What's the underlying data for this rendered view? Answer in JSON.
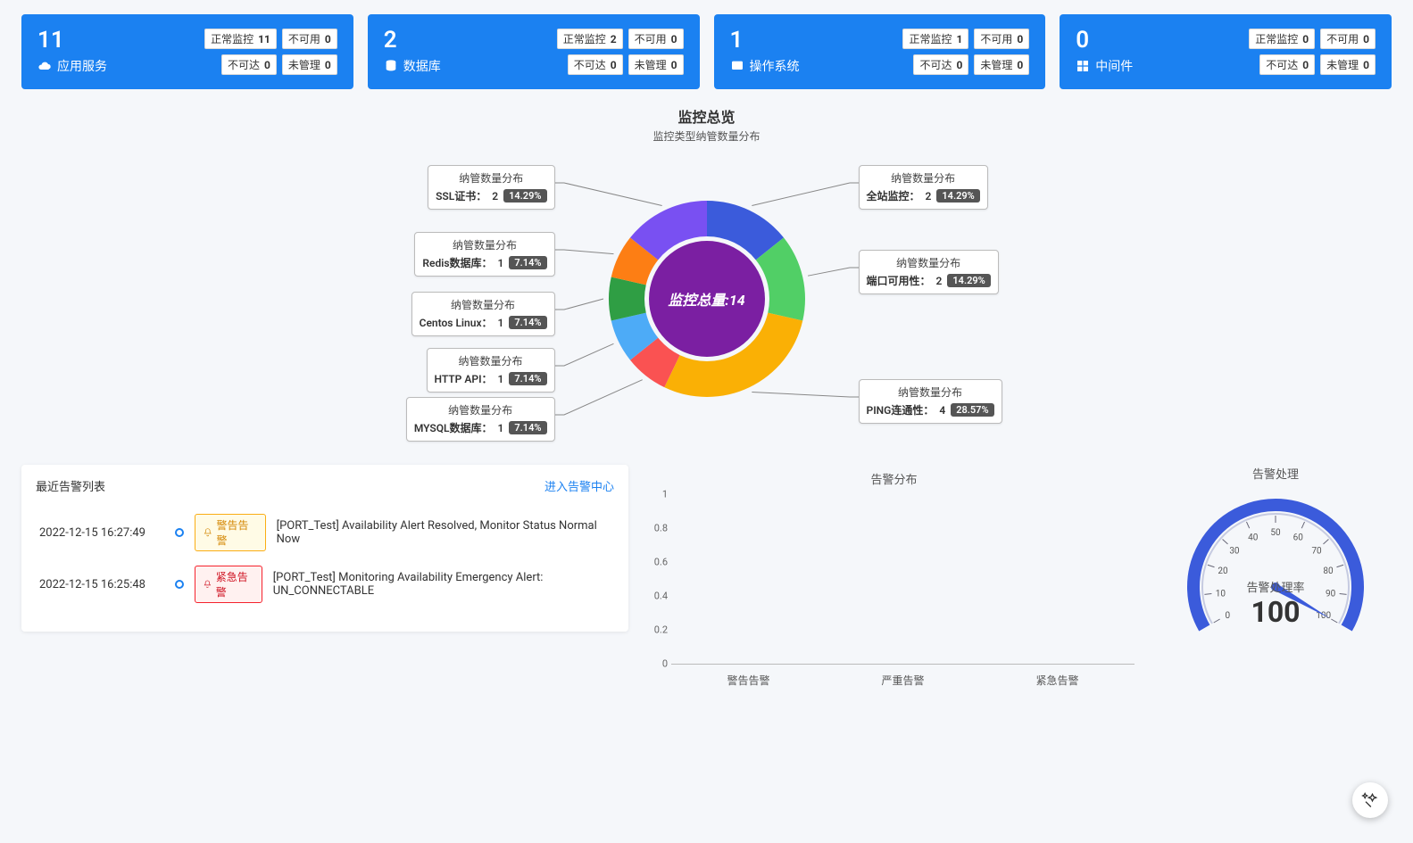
{
  "stat_labels": {
    "normal": "正常监控",
    "unavailable": "不可用",
    "unreachable": "不可达",
    "unmanaged": "未管理"
  },
  "cards": [
    {
      "count": "11",
      "title": "应用服务",
      "normal": "11",
      "unavailable": "0",
      "unreachable": "0",
      "unmanaged": "0"
    },
    {
      "count": "2",
      "title": "数据库",
      "normal": "2",
      "unavailable": "0",
      "unreachable": "0",
      "unmanaged": "0"
    },
    {
      "count": "1",
      "title": "操作系统",
      "normal": "1",
      "unavailable": "0",
      "unreachable": "0",
      "unmanaged": "0"
    },
    {
      "count": "0",
      "title": "中间件",
      "normal": "0",
      "unavailable": "0",
      "unreachable": "0",
      "unmanaged": "0"
    }
  ],
  "overview": {
    "title": "监控总览",
    "subtitle": "监控类型纳管数量分布",
    "center_text": "监控总量:14",
    "label_header": "纳管数量分布"
  },
  "chart_data": {
    "type": "pie",
    "title": "监控类型纳管数量分布",
    "total": 14,
    "series": [
      {
        "name": "全站监控",
        "value": 2,
        "pct": "14.29%",
        "color": "#3b5bdb"
      },
      {
        "name": "端口可用性",
        "value": 2,
        "pct": "14.29%",
        "color": "#51cf66"
      },
      {
        "name": "PING连通性",
        "value": 4,
        "pct": "28.57%",
        "color": "#fab005"
      },
      {
        "name": "MYSQL数据库",
        "value": 1,
        "pct": "7.14%",
        "color": "#fa5252"
      },
      {
        "name": "HTTP API",
        "value": 1,
        "pct": "7.14%",
        "color": "#4dabf7"
      },
      {
        "name": "Centos Linux",
        "value": 1,
        "pct": "7.14%",
        "color": "#2f9e44"
      },
      {
        "name": "Redis数据库",
        "value": 1,
        "pct": "7.14%",
        "color": "#fd7e14"
      },
      {
        "name": "SSL证书",
        "value": 2,
        "pct": "14.29%",
        "color": "#7950f2"
      }
    ]
  },
  "alerts": {
    "title": "最近告警列表",
    "link": "进入告警中心",
    "tags": {
      "warn": "警告告警",
      "crit": "紧急告警"
    },
    "items": [
      {
        "time": "2022-12-15 16:27:49",
        "level": "warn",
        "msg": "[PORT_Test] Availability Alert Resolved, Monitor Status Normal Now"
      },
      {
        "time": "2022-12-15 16:25:48",
        "level": "crit",
        "msg": "[PORT_Test] Monitoring Availability Emergency Alert: UN_CONNECTABLE"
      }
    ]
  },
  "dist": {
    "title": "告警分布",
    "ylim": [
      0,
      1
    ],
    "yticks": [
      "0",
      "0.2",
      "0.4",
      "0.6",
      "0.8",
      "1"
    ],
    "categories": [
      "警告告警",
      "严重告警",
      "紧急告警"
    ],
    "values": [
      0,
      0,
      0
    ]
  },
  "gauge": {
    "title": "告警处理",
    "label": "告警处理率",
    "value": "100",
    "min": 0,
    "max": 100,
    "ticks": [
      "0",
      "10",
      "20",
      "30",
      "40",
      "50",
      "60",
      "70",
      "80",
      "90",
      "100"
    ]
  }
}
